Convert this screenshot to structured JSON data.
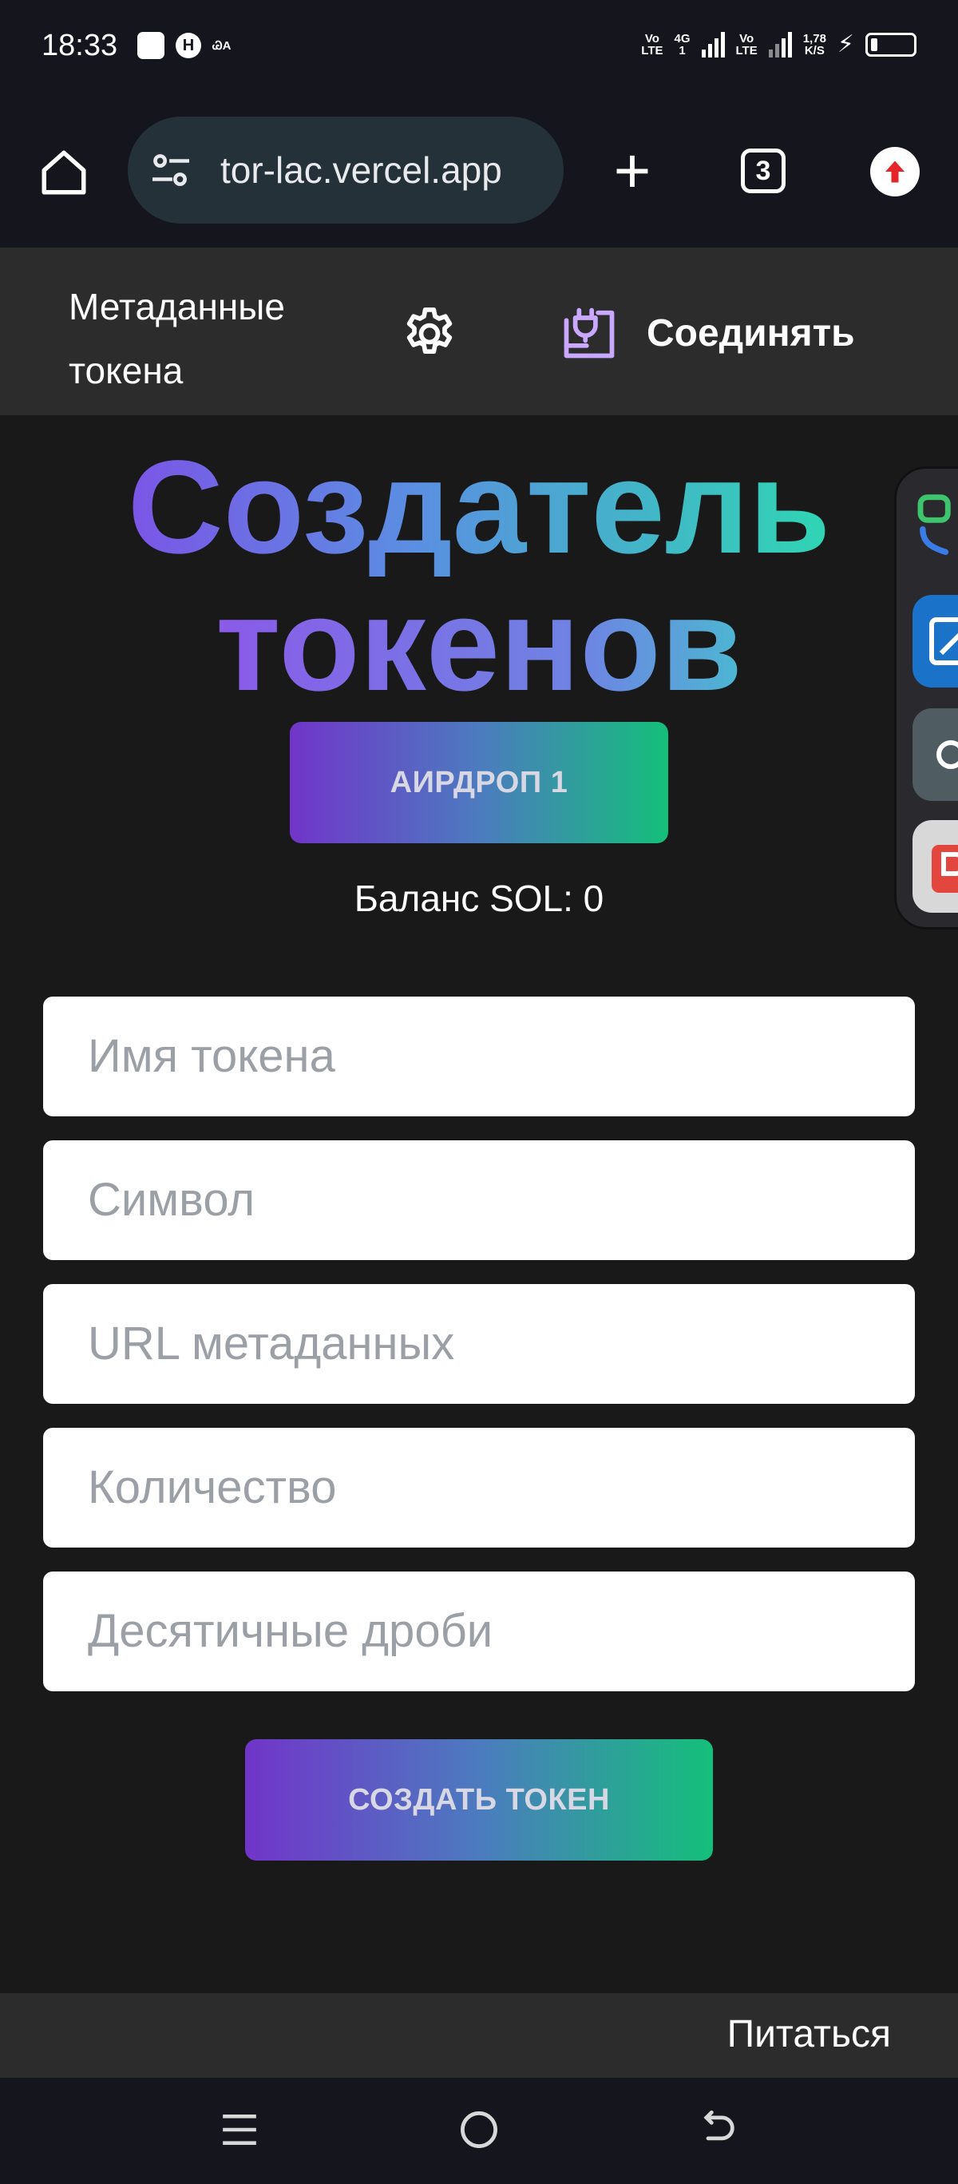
{
  "status_bar": {
    "time": "18:33",
    "h_badge": "H",
    "ca_text_top": "ᏊA",
    "volte1": [
      "Vo",
      "LTE"
    ],
    "net": [
      "4G",
      "1"
    ],
    "volte2": [
      "Vo",
      "LTE"
    ],
    "speed": [
      "1,78",
      "K/S"
    ],
    "icons": [
      "notification-square-icon",
      "h-badge-icon",
      "signal-icon",
      "charging-icon",
      "battery-icon"
    ]
  },
  "browser": {
    "url": "tor-lac.vercel.app",
    "tab_count": "3",
    "icons": [
      "home-icon",
      "site-settings-icon",
      "new-tab-icon",
      "tab-switcher-icon",
      "update-icon"
    ]
  },
  "header": {
    "metadata_link": "Метаданные токена",
    "connect_label": "Соединять",
    "icons": [
      "gear-icon",
      "plug-icon"
    ]
  },
  "main": {
    "title_line1": "Создатель",
    "title_line2": "токенов",
    "airdrop_button": "АИРДРОП 1",
    "balance": "Баланс SOL: 0",
    "fields": {
      "name_placeholder": "Имя токена",
      "symbol_placeholder": "Символ",
      "url_placeholder": "URL метаданных",
      "amount_placeholder": "Количество",
      "decimals_placeholder": "Десятичные дроби"
    },
    "create_button": "СОЗДАТЬ ТОКЕН"
  },
  "footer": {
    "power_link": "Питаться"
  },
  "nav": {
    "icons": [
      "menu-icon",
      "home-circle-icon",
      "back-icon"
    ]
  },
  "colors": {
    "page_bg": "#191919",
    "header_bg": "#2c2c2c",
    "system_bg": "#14151d",
    "gradient_start": "#7135c9",
    "gradient_end": "#14bf7a",
    "accent_icon": "#c9a8ff"
  }
}
